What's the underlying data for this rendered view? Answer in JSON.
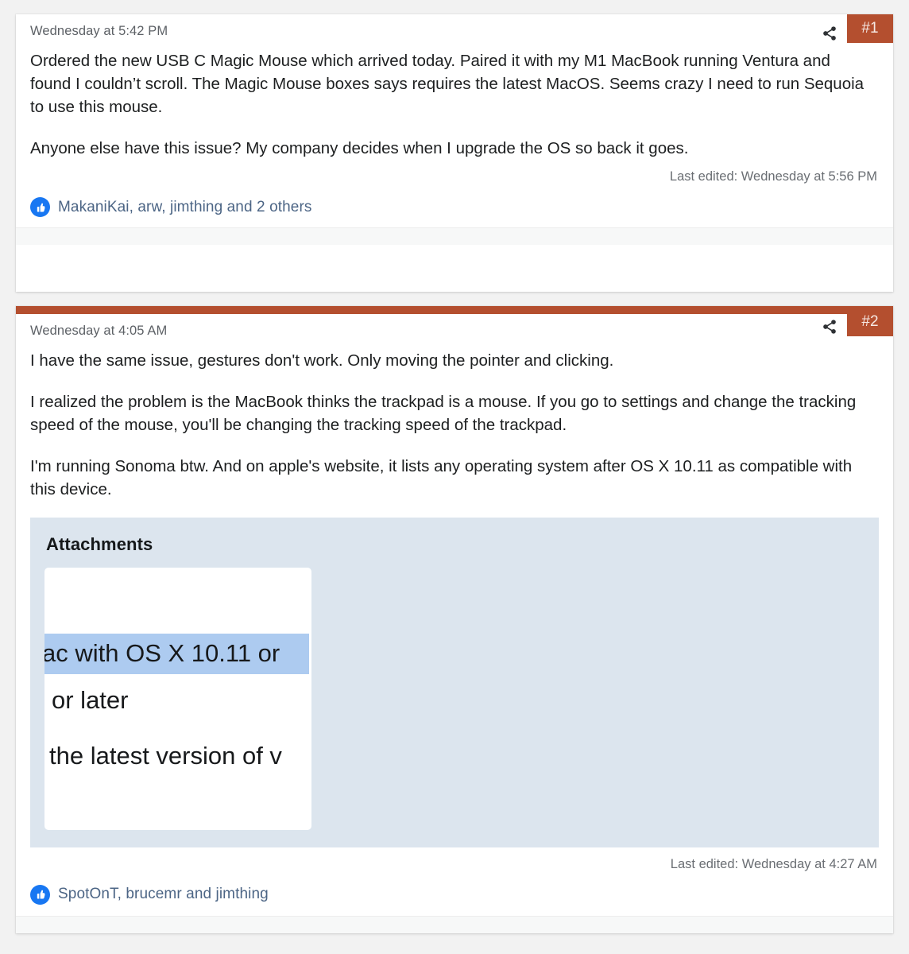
{
  "theme": {
    "page_background": "#f2f2f2",
    "card_background": "#ffffff",
    "accent": "#b44f2f",
    "link": "#4c6585",
    "attachment_panel": "#dce5ee",
    "highlight": "#adcbf0",
    "like_blue": "#1877f2"
  },
  "posts": [
    {
      "date": "Wednesday at 5:42 PM",
      "share_icon": "share-icon",
      "number": "#1",
      "paragraphs": [
        "Ordered the new USB C Magic Mouse which arrived today. Paired it with my M1 MacBook running Ventura and found I couldn’t scroll. The Magic Mouse boxes says requires the latest MacOS. Seems crazy I need to run Sequoia to use this mouse.",
        "Anyone else have this issue? My company decides when I upgrade the OS so back it goes."
      ],
      "last_edited": "Last edited: Wednesday at 5:56 PM",
      "like_icon": "thumbs-up-icon",
      "likes_text": "MakaniKai, arw, jimthing and 2 others"
    },
    {
      "date": "Wednesday at 4:05 AM",
      "share_icon": "share-icon",
      "number": "#2",
      "paragraphs": [
        "I have the same issue, gestures don't work. Only moving the pointer and clicking.",
        "I realized the problem is the MacBook thinks the trackpad is a mouse. If you go to settings and change the tracking speed of the mouse, you'll be changing the tracking speed of the trackpad.",
        "I'm running Sonoma btw. And on apple's website, it lists any operating system after OS X 10.11 as compatible with this device."
      ],
      "attachments": {
        "title": "Attachments",
        "thumbnail": {
          "name": "attachment-thumbnail",
          "lines": [
            "ac with OS X 10.11 or",
            "or later",
            "the latest version of v"
          ]
        }
      },
      "last_edited": "Last edited: Wednesday at 4:27 AM",
      "like_icon": "thumbs-up-icon",
      "likes_text": "SpotOnT, brucemr and jimthing"
    }
  ]
}
